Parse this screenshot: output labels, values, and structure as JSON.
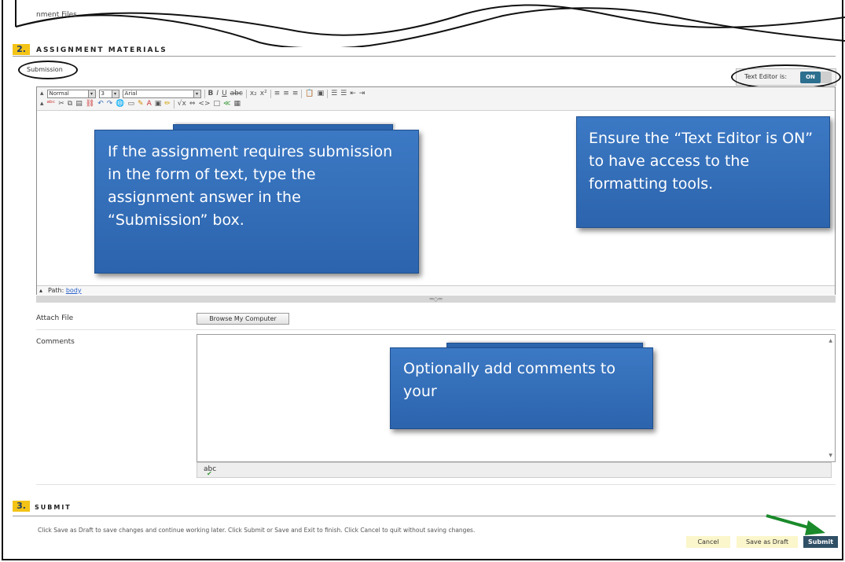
{
  "top": {
    "section_label": "nment Files"
  },
  "section2": {
    "number": "2.",
    "title": "ASSIGNMENT MATERIALS"
  },
  "submission": {
    "label": "Submission"
  },
  "text_editor": {
    "label": "Text Editor is:",
    "state": "ON"
  },
  "toolbar": {
    "format_select": "Normal",
    "size_select": "3",
    "font_select": "Arial",
    "row1_icons": [
      "bold-icon",
      "italic-icon",
      "underline-icon",
      "strikethrough-icon",
      "subscript-icon",
      "superscript-icon",
      "align-left-icon",
      "align-center-icon",
      "align-right-icon",
      "paste-icon",
      "paste-word-icon",
      "numbered-list-icon",
      "bulleted-list-icon",
      "outdent-icon",
      "indent-icon"
    ],
    "row2_icons": [
      "spellcheck-icon",
      "cut-icon",
      "copy-icon",
      "paste-icon",
      "unlink-icon",
      "undo-icon",
      "redo-icon",
      "insert-link-icon",
      "insert-image-icon",
      "pencil-icon",
      "text-color-icon",
      "media-icon",
      "highlighter-icon",
      "equation-icon",
      "embed-icon",
      "html-icon",
      "preview-icon",
      "mashup-icon",
      "spreadsheet-icon"
    ]
  },
  "path": {
    "label": "Path:",
    "value": "body"
  },
  "callouts": {
    "submission_text": "If the assignment requires submission in the form of text, type the assignment answer in the “Submission” box.",
    "editor_text": "Ensure the “Text Editor is ON” to have access to the formatting tools.",
    "comments_text": "Optionally add comments to your"
  },
  "attach": {
    "label": "Attach File",
    "button": "Browse My Computer"
  },
  "comments": {
    "label": "Comments",
    "spell_icon": "abc"
  },
  "section3": {
    "number": "3.",
    "title": "SUBMIT"
  },
  "submit_section": {
    "instructions": "Click Save as Draft to save changes and continue working later. Click Submit or Save and Exit to finish. Click Cancel to quit without saving changes.",
    "cancel": "Cancel",
    "save_draft": "Save as Draft",
    "submit": "Submit"
  },
  "colors": {
    "section_number_bg": "#f3c316",
    "callout_blue": "#3470b9",
    "toggle_on": "#2d6f8f",
    "submit_bg": "#2f4f65",
    "arrow_green": "#1a8a2a"
  }
}
